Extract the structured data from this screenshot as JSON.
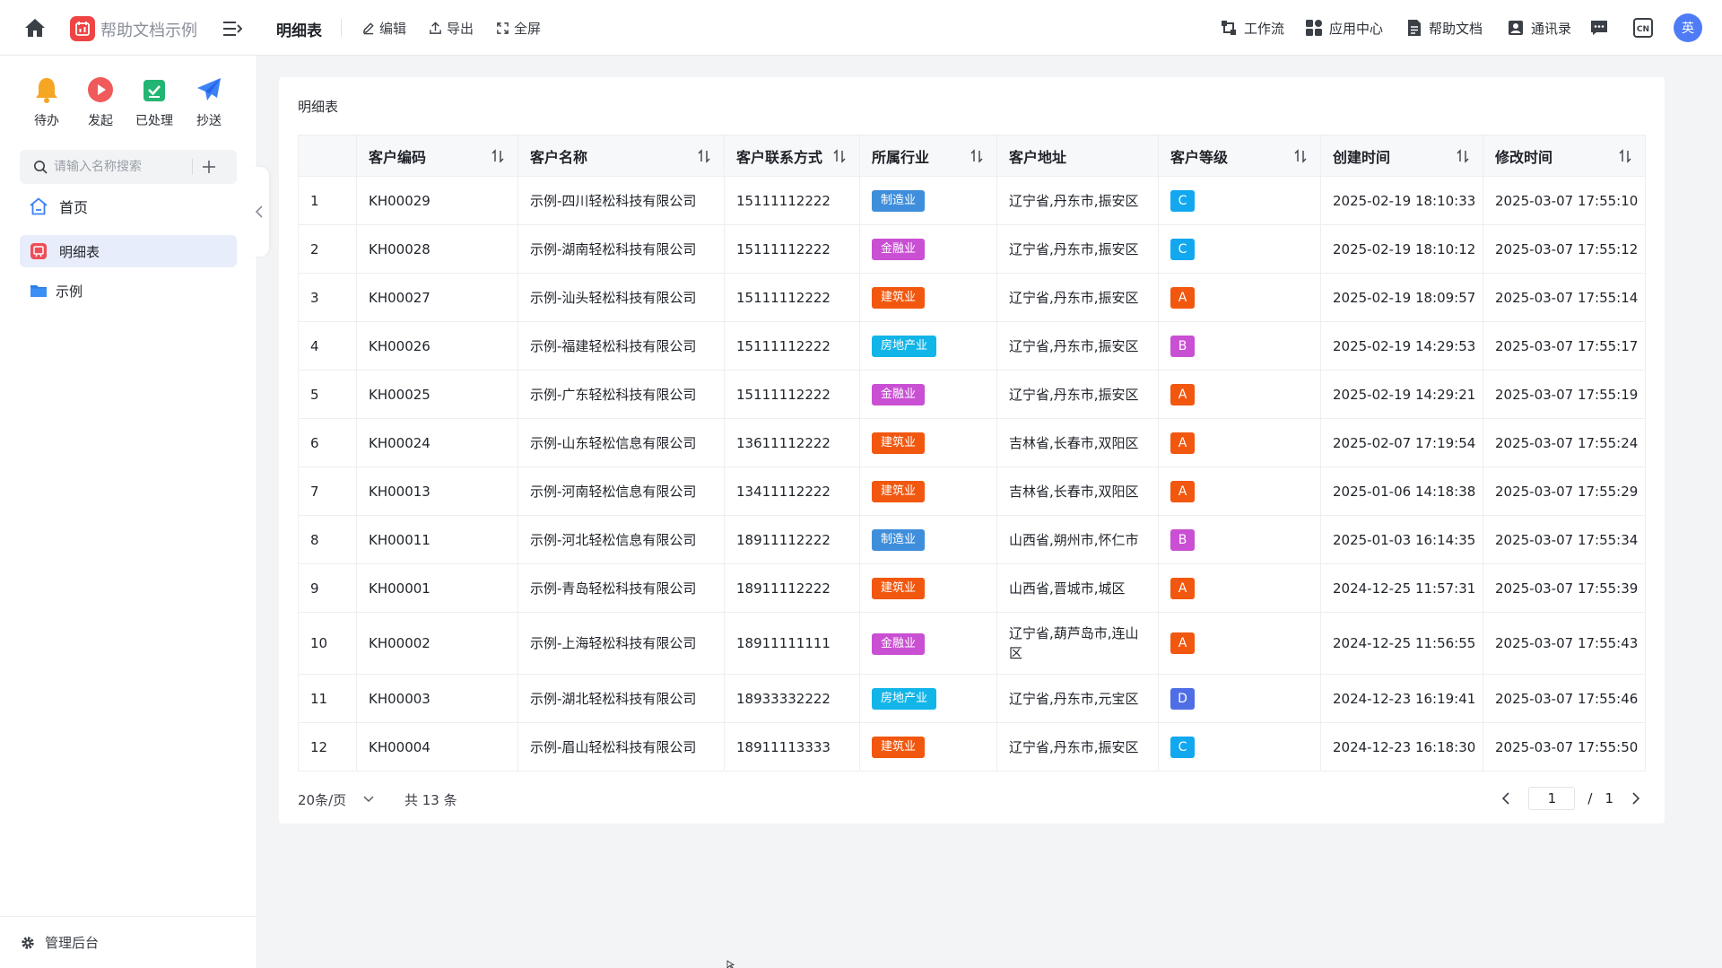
{
  "header": {
    "app_name": "帮助文档示例",
    "page_title": "明细表",
    "actions": [
      {
        "id": "edit",
        "label": "编辑",
        "icon": "edit-icon"
      },
      {
        "id": "export",
        "label": "导出",
        "icon": "export-icon"
      },
      {
        "id": "fullscreen",
        "label": "全屏",
        "icon": "fullscreen-icon"
      }
    ],
    "nav": [
      {
        "id": "workflow",
        "label": "工作流",
        "icon": "workflow-icon"
      },
      {
        "id": "app-center",
        "label": "应用中心",
        "icon": "grid-icon"
      },
      {
        "id": "help-docs",
        "label": "帮助文档",
        "icon": "document-icon"
      },
      {
        "id": "contacts",
        "label": "通讯录",
        "icon": "contacts-icon"
      }
    ],
    "avatar_text": "英",
    "lang_badge": "CN"
  },
  "sidebar": {
    "quick_actions": [
      {
        "label": "待办",
        "icon": "bell-icon",
        "color": "#f5a623"
      },
      {
        "label": "发起",
        "icon": "play-icon",
        "color": "#f05a5a"
      },
      {
        "label": "已处理",
        "icon": "done-icon",
        "color": "#22b573"
      },
      {
        "label": "抄送",
        "icon": "send-icon",
        "color": "#3b82f6"
      }
    ],
    "search_placeholder": "请输入名称搜索",
    "items": [
      {
        "label": "首页",
        "icon": "home-icon"
      },
      {
        "label": "明细表",
        "icon": "table-app-icon",
        "active": true
      },
      {
        "label": "示例",
        "icon": "folder-icon"
      }
    ],
    "bottom_label": "管理后台"
  },
  "main": {
    "card_title": "明细表",
    "columns": [
      "",
      "客户编码",
      "客户名称",
      "客户联系方式",
      "所属行业",
      "客户地址",
      "客户等级",
      "创建时间",
      "修改时间"
    ],
    "rows": [
      {
        "no": "1",
        "code": "KH00029",
        "name": "示例-四川轻松科技有限公司",
        "phone": "15111112222",
        "industry": "制造业",
        "address": "辽宁省,丹东市,振安区",
        "grade": "C",
        "created": "2025-02-19 18:10:33",
        "modified": "2025-03-07 17:55:10"
      },
      {
        "no": "2",
        "code": "KH00028",
        "name": "示例-湖南轻松科技有限公司",
        "phone": "15111112222",
        "industry": "金融业",
        "address": "辽宁省,丹东市,振安区",
        "grade": "C",
        "created": "2025-02-19 18:10:12",
        "modified": "2025-03-07 17:55:12"
      },
      {
        "no": "3",
        "code": "KH00027",
        "name": "示例-汕头轻松科技有限公司",
        "phone": "15111112222",
        "industry": "建筑业",
        "address": "辽宁省,丹东市,振安区",
        "grade": "A",
        "created": "2025-02-19 18:09:57",
        "modified": "2025-03-07 17:55:14"
      },
      {
        "no": "4",
        "code": "KH00026",
        "name": "示例-福建轻松科技有限公司",
        "phone": "15111112222",
        "industry": "房地产业",
        "address": "辽宁省,丹东市,振安区",
        "grade": "B",
        "created": "2025-02-19 14:29:53",
        "modified": "2025-03-07 17:55:17"
      },
      {
        "no": "5",
        "code": "KH00025",
        "name": "示例-广东轻松科技有限公司",
        "phone": "15111112222",
        "industry": "金融业",
        "address": "辽宁省,丹东市,振安区",
        "grade": "A",
        "created": "2025-02-19 14:29:21",
        "modified": "2025-03-07 17:55:19"
      },
      {
        "no": "6",
        "code": "KH00024",
        "name": "示例-山东轻松信息有限公司",
        "phone": "13611112222",
        "industry": "建筑业",
        "address": "吉林省,长春市,双阳区",
        "grade": "A",
        "created": "2025-02-07 17:19:54",
        "modified": "2025-03-07 17:55:24"
      },
      {
        "no": "7",
        "code": "KH00013",
        "name": "示例-河南轻松信息有限公司",
        "phone": "13411112222",
        "industry": "建筑业",
        "address": "吉林省,长春市,双阳区",
        "grade": "A",
        "created": "2025-01-06 14:18:38",
        "modified": "2025-03-07 17:55:29"
      },
      {
        "no": "8",
        "code": "KH00011",
        "name": "示例-河北轻松信息有限公司",
        "phone": "18911112222",
        "industry": "制造业",
        "address": "山西省,朔州市,怀仁市",
        "grade": "B",
        "created": "2025-01-03 16:14:35",
        "modified": "2025-03-07 17:55:34"
      },
      {
        "no": "9",
        "code": "KH00001",
        "name": "示例-青岛轻松科技有限公司",
        "phone": "18911112222",
        "industry": "建筑业",
        "address": "山西省,晋城市,城区",
        "grade": "A",
        "created": "2024-12-25 11:57:31",
        "modified": "2025-03-07 17:55:39"
      },
      {
        "no": "10",
        "code": "KH00002",
        "name": "示例-上海轻松科技有限公司",
        "phone": "18911111111",
        "industry": "金融业",
        "address": "辽宁省,葫芦岛市,连山区",
        "grade": "A",
        "created": "2024-12-25 11:56:55",
        "modified": "2025-03-07 17:55:43"
      },
      {
        "no": "11",
        "code": "KH00003",
        "name": "示例-湖北轻松科技有限公司",
        "phone": "18933332222",
        "industry": "房地产业",
        "address": "辽宁省,丹东市,元宝区",
        "grade": "D",
        "created": "2024-12-23 16:19:41",
        "modified": "2025-03-07 17:55:46"
      },
      {
        "no": "12",
        "code": "KH00004",
        "name": "示例-眉山轻松科技有限公司",
        "phone": "18911113333",
        "industry": "建筑业",
        "address": "辽宁省,丹东市,振安区",
        "grade": "C",
        "created": "2024-12-23 16:18:30",
        "modified": "2025-03-07 17:55:50"
      }
    ],
    "industry_colors": {
      "制造业": "#3f8edb",
      "金融业": "#c94fd3",
      "建筑业": "#f2570f",
      "房地产业": "#12b5e8"
    },
    "grade_colors": {
      "A": "#f2570f",
      "B": "#c94fd3",
      "C": "#12a8f0",
      "D": "#4f6ee6"
    },
    "pagination": {
      "page_size": "20条/页",
      "total": "共 13 条",
      "current": "1",
      "separator": "/",
      "pages": "1"
    }
  }
}
